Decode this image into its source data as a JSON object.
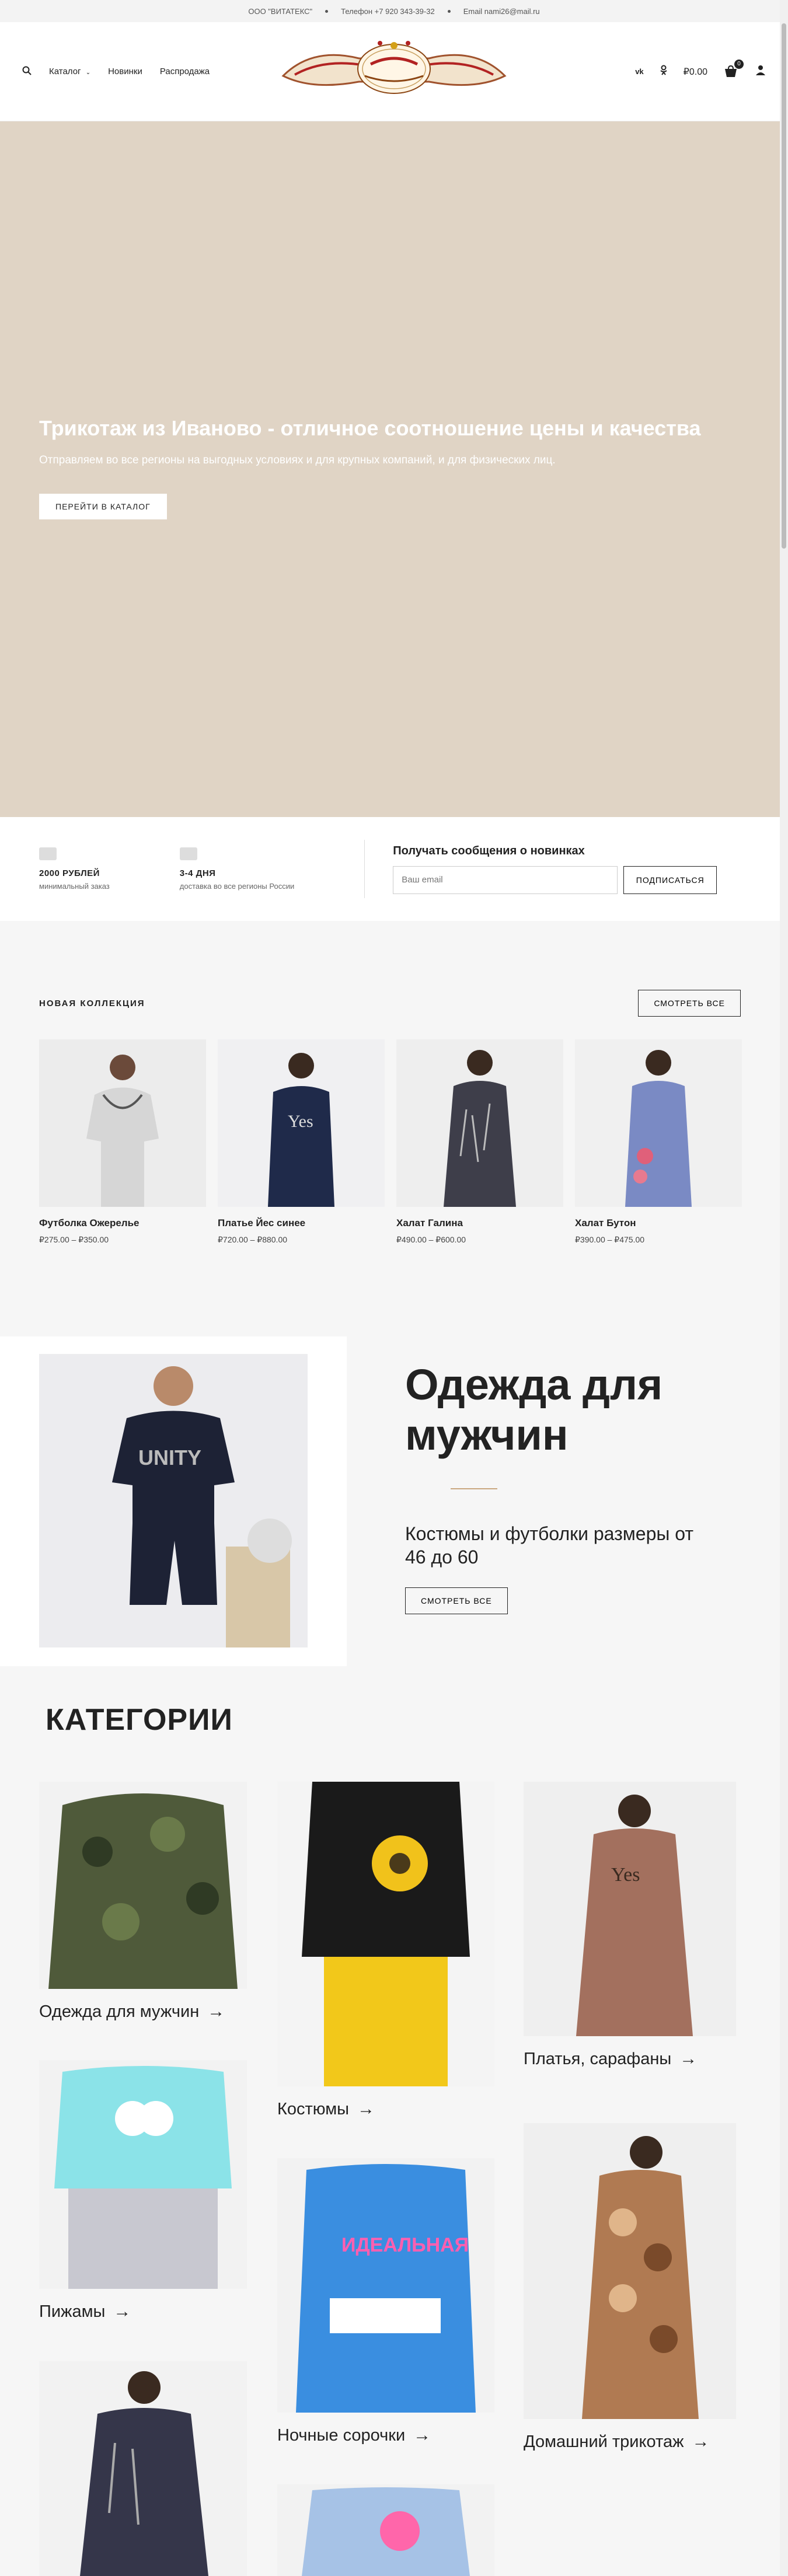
{
  "topbar": {
    "company": "ООО \"ВИТАТЕКС\"",
    "phone": "Телефон +7 920 343-39-32",
    "email": "Email nami26@mail.ru"
  },
  "nav": {
    "catalog": "Каталог",
    "new": "Новинки",
    "sale": "Распродажа",
    "cart_total": "₽0.00",
    "cart_count": "0"
  },
  "hero": {
    "title": "Трикотаж из Иваново - отличное соотношение цены и качества",
    "subtitle": "Отправляем во все регионы на выгодных условиях и для крупных компаний, и для физических лиц.",
    "button": "ПЕРЕЙТИ В КАТАЛОГ"
  },
  "features": {
    "min_order_title": "2000 РУБЛЕЙ",
    "min_order_sub": "минимальный заказ",
    "delivery_title": "3-4 ДНЯ",
    "delivery_sub": "доставка во все регионы России"
  },
  "newsletter": {
    "title": "Получать сообщения о новинках",
    "placeholder": "Ваш email",
    "button": "ПОДПИСАТЬСЯ"
  },
  "collection": {
    "label": "НОВАЯ КОЛЛЕКЦИЯ",
    "view_all": "СМОТРЕТЬ ВСЕ",
    "products": [
      {
        "name": "Футболка Ожерелье",
        "price": "₽275.00 – ₽350.00"
      },
      {
        "name": "Платье Йес синее",
        "price": "₽720.00 – ₽880.00"
      },
      {
        "name": "Халат Галина",
        "price": "₽490.00 – ₽600.00"
      },
      {
        "name": "Халат Бутон",
        "price": "₽390.00 – ₽475.00"
      }
    ]
  },
  "men": {
    "title": "Одежда для мужчин",
    "subtitle": "Костюмы и футболки размеры от 46 до 60",
    "button": "СМОТРЕТЬ ВСЕ"
  },
  "categories": {
    "title": "КАТЕГОРИИ",
    "items": [
      {
        "label": "Одежда для мужчин"
      },
      {
        "label": "Костюмы"
      },
      {
        "label": "Платья, сарафаны"
      },
      {
        "label": "Пижамы"
      },
      {
        "label": "Ночные сорочки"
      },
      {
        "label": "Домашний трикотаж"
      }
    ]
  },
  "colors": {
    "hero_bg": "#e0d4c5",
    "accent": "#caa780"
  }
}
